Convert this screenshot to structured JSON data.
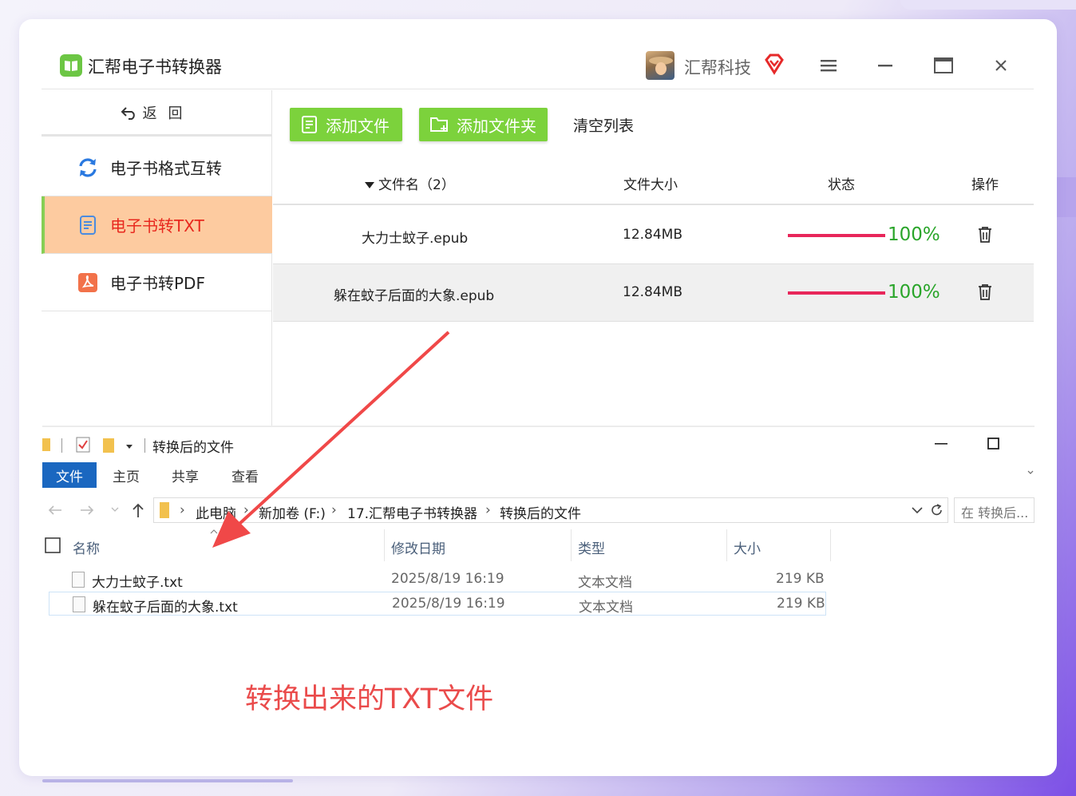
{
  "app": {
    "title": "汇帮电子书转换器",
    "company": "汇帮科技",
    "back_label": "返回",
    "nav": [
      {
        "label": "电子书格式互转",
        "icon": "refresh-icon",
        "active": false
      },
      {
        "label": "电子书转TXT",
        "icon": "txt-doc-icon",
        "active": true
      },
      {
        "label": "电子书转PDF",
        "icon": "pdf-icon",
        "active": false
      }
    ],
    "toolbar": {
      "add_file": "添加文件",
      "add_folder": "添加文件夹",
      "clear_list": "清空列表"
    },
    "table": {
      "headers": {
        "name": "文件名（2）",
        "size": "文件大小",
        "status": "状态",
        "action": "操作"
      },
      "rows": [
        {
          "name": "大力士蚊子.epub",
          "size": "12.84MB",
          "progress": "100%"
        },
        {
          "name": "躲在蚊子后面的大象.epub",
          "size": "12.84MB",
          "progress": "100%"
        }
      ]
    },
    "colors": {
      "accent_green": "#7cd23c",
      "active_bg": "#fdcba0",
      "progress_bar": "#e8265a",
      "progress_text": "#2aa52a"
    }
  },
  "explorer": {
    "title": "转换后的文件",
    "ribbon_tabs": [
      "文件",
      "主页",
      "共享",
      "查看"
    ],
    "breadcrumb": [
      "此电脑",
      "新加卷 (F:)",
      "17.汇帮电子书转换器",
      "转换后的文件"
    ],
    "search_placeholder": "在 转换后...",
    "columns": {
      "name": "名称",
      "date": "修改日期",
      "type": "类型",
      "size": "大小"
    },
    "files": [
      {
        "name": "大力士蚊子.txt",
        "date": "2025/8/19 16:19",
        "type": "文本文档",
        "size": "219 KB"
      },
      {
        "name": "躲在蚊子后面的大象.txt",
        "date": "2025/8/19 16:19",
        "type": "文本文档",
        "size": "219 KB"
      }
    ]
  },
  "annotation": "转换出来的TXT文件"
}
